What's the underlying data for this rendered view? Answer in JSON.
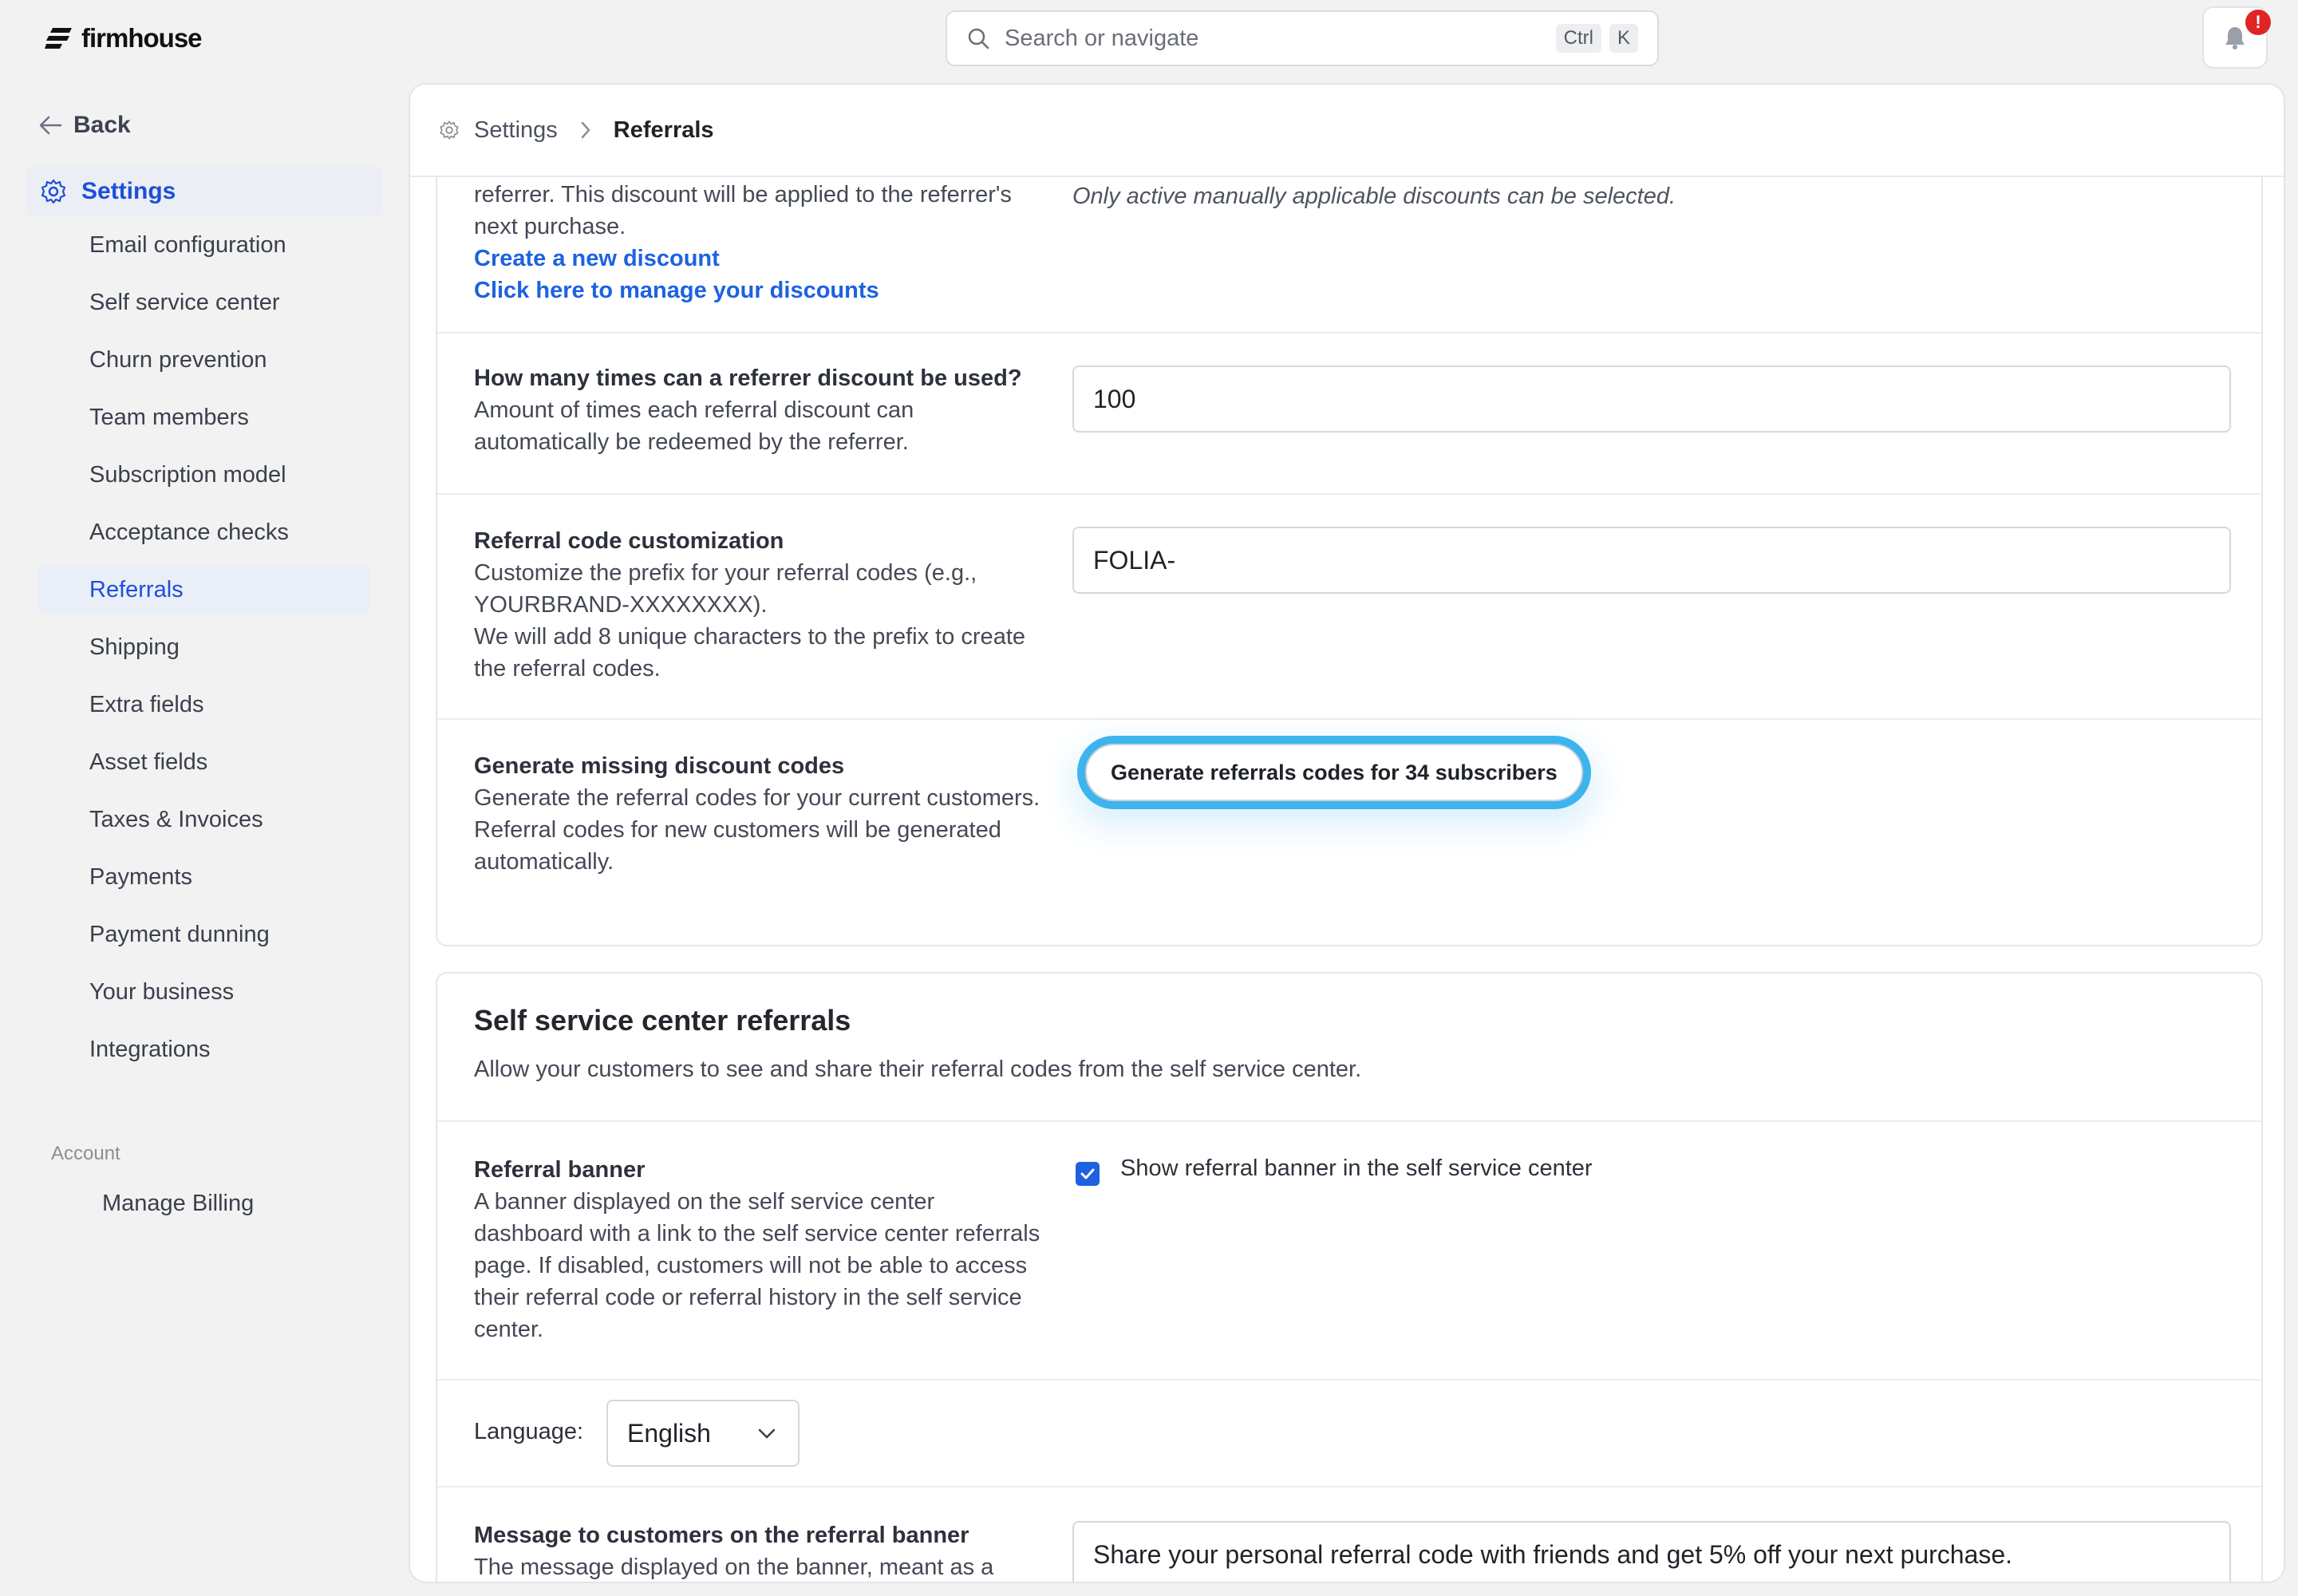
{
  "app": {
    "brand": "firmhouse",
    "search_placeholder": "Search or navigate",
    "shortcut_keys": [
      "Ctrl",
      "K"
    ],
    "notification_badge": "!"
  },
  "sidebar": {
    "back_label": "Back",
    "active_section": "Settings",
    "items": [
      {
        "label": "Email configuration"
      },
      {
        "label": "Self service center"
      },
      {
        "label": "Churn prevention"
      },
      {
        "label": "Team members"
      },
      {
        "label": "Subscription model"
      },
      {
        "label": "Acceptance checks"
      },
      {
        "label": "Referrals",
        "active": true
      },
      {
        "label": "Shipping"
      },
      {
        "label": "Extra fields"
      },
      {
        "label": "Asset fields"
      },
      {
        "label": "Taxes & Invoices"
      },
      {
        "label": "Payments"
      },
      {
        "label": "Payment dunning"
      },
      {
        "label": "Your business"
      },
      {
        "label": "Integrations"
      }
    ],
    "account_heading": "Account",
    "account_items": [
      {
        "label": "Manage Billing"
      }
    ]
  },
  "breadcrumb": {
    "parent": "Settings",
    "current": "Referrals"
  },
  "referrer_discount": {
    "desc_line1": "referrer. This discount will be applied to the referrer's",
    "desc_line2": "next purchase.",
    "create_link": "Create a new discount",
    "manage_link": "Click here to manage your discounts",
    "hint": "Only active manually applicable discounts can be selected."
  },
  "usage_limit": {
    "title": "How many times can a referrer discount be used?",
    "desc": "Amount of times each referral discount can automatically be redeemed by the referrer.",
    "value": "100"
  },
  "code_customization": {
    "title": "Referral code customization",
    "desc1": "Customize the prefix for your referral codes (e.g., YOURBRAND-XXXXXXXX).",
    "desc2": "We will add 8 unique characters to the prefix to create the referral codes.",
    "value": "FOLIA-"
  },
  "generate_codes": {
    "title": "Generate missing discount codes",
    "desc1": "Generate the referral codes for your current customers.",
    "desc2": "Referral codes for new customers will be generated automatically.",
    "button": "Generate referrals codes for 34 subscribers"
  },
  "self_service": {
    "title": "Self service center referrals",
    "desc": "Allow your customers to see and share their referral codes from the self service center.",
    "banner_title": "Referral banner",
    "banner_desc": "A banner displayed on the self service center dashboard with a link to the self service center referrals page. If disabled, customers will not be able to access their referral code or referral history in the self service center.",
    "banner_checkbox_label": "Show referral banner in the self service center",
    "banner_checked": true,
    "language_label": "Language:",
    "language_value": "English",
    "message_title": "Message to customers on the referral banner",
    "message_desc": "The message displayed on the banner, meant as a",
    "message_value": "Share your personal referral code with friends and get 5% off your next purchase."
  },
  "colors": {
    "accent": "#1d62e0",
    "focus_ring": "#3cb4ee",
    "badge": "#e02424"
  }
}
